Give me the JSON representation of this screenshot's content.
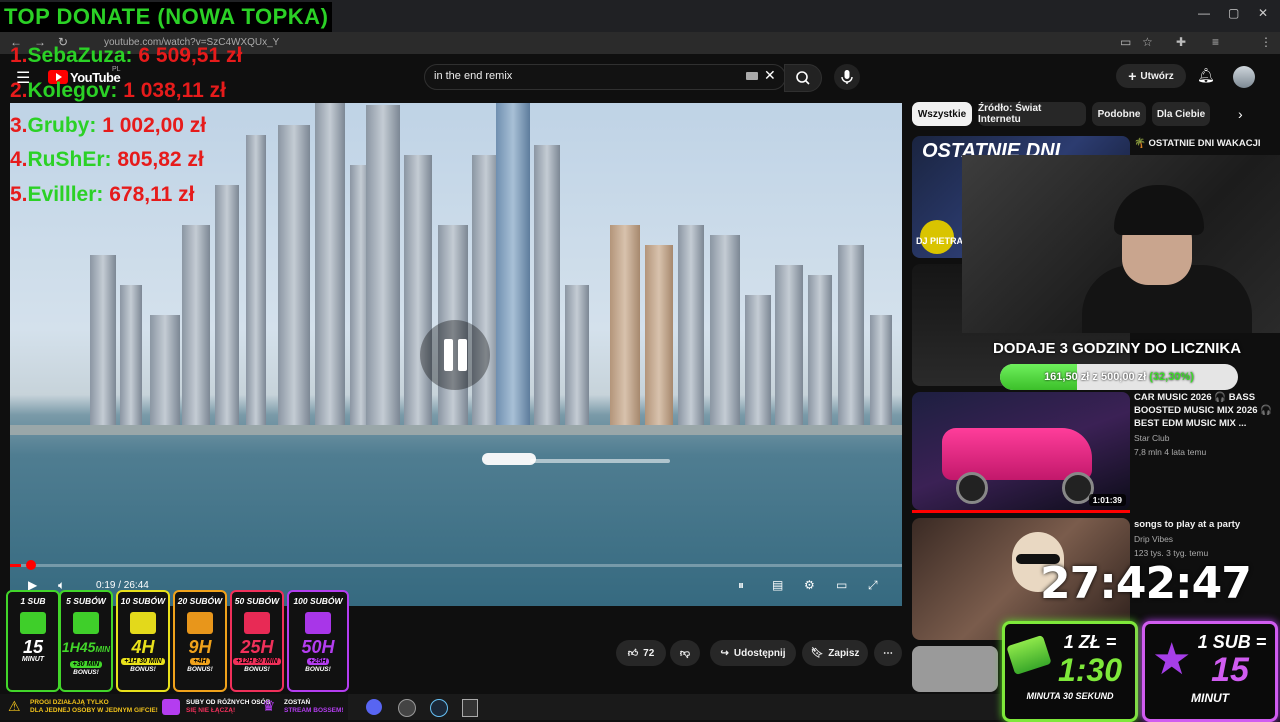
{
  "browser": {
    "url": "youtube.com/watch?v=SzC4WXQUx_Y",
    "window_controls": [
      "—",
      "▢",
      "✕"
    ]
  },
  "youtube": {
    "logo_text": "YouTube",
    "region": "PL",
    "search_query": "in the end remix",
    "create_label": "Utwórz"
  },
  "overlay": {
    "top_donate_title": "TOP DONATE (NOWA TOPKA)",
    "donors": [
      {
        "rank": "1.",
        "name": "SebaZuza:",
        "amount": "6 509,51 zł"
      },
      {
        "rank": "2.",
        "name": "Kolegov:",
        "amount": "1 038,11 zł"
      },
      {
        "rank": "3.",
        "name": "Gruby:",
        "amount": "1 002,00 zł"
      },
      {
        "rank": "4.",
        "name": "RuShEr:",
        "amount": "805,82 zł"
      },
      {
        "rank": "5.",
        "name": "Evilller:",
        "amount": "678,11 zł"
      }
    ],
    "goal_title": "DODAJE 3 GODZINY DO LICZNIKA",
    "goal_current": "161,50 zł",
    "goal_separator": "z",
    "goal_target": "500,00 zł",
    "goal_percent": "(32,30%)",
    "goal_fraction": 0.323,
    "timer": "27:42:47"
  },
  "player": {
    "current_time": "0:19",
    "duration": "26:44",
    "time_display": "0:19 / 26:44",
    "progress_fraction": 0.012
  },
  "sidebar": {
    "chips": [
      "Wszystkie",
      "Źródło: Świat Internetu",
      "Podobne",
      "Dla Ciebie"
    ],
    "videos": [
      {
        "title": "🌴 OSTATNIE DNI WAKACJI",
        "thumb_text": "OSTATNIE DNI",
        "thumb_sub": "DJ PIETRASS",
        "channel": "",
        "meta": ""
      },
      {
        "title": "CAR MUSIC 2026 🎧 BASS BOOSTED MUSIC MIX 2026 🎧 BEST EDM MUSIC MIX ...",
        "channel": "Star Club",
        "meta": "7,8 mln  4 lata temu",
        "duration": "1:01:39"
      },
      {
        "title": "songs to play at a party",
        "channel": "Drip Vibes",
        "meta": "123 tys.  3 tyg. temu"
      }
    ]
  },
  "actions": {
    "likes": "72",
    "share": "Udostępnij",
    "save": "Zapisz",
    "more": "⋯"
  },
  "tiers": [
    {
      "label": "1 SUB",
      "time": "15",
      "unit": "MINUT",
      "bonus": "",
      "color": "#42d62a",
      "gift": "#3fcf2a"
    },
    {
      "label": "5 SUBÓW",
      "time": "1H45",
      "unit": "MIN",
      "bonus": "+30 MIN",
      "bonus2": "BONUS!",
      "color": "#42d62a",
      "gift": "#3fcf2a"
    },
    {
      "label": "10 SUBÓW",
      "time": "4H",
      "unit": "",
      "bonus": "+1H 30 MIN",
      "bonus2": "BONUS!",
      "color": "#e9e11b",
      "gift": "#e3d91b"
    },
    {
      "label": "20 SUBÓW",
      "time": "9H",
      "unit": "",
      "bonus": "+4H",
      "bonus2": "BONUS!",
      "color": "#f0a21b",
      "gift": "#e8961b"
    },
    {
      "label": "50 SUBÓW",
      "time": "25H",
      "unit": "",
      "bonus": "+12H 30 MIN",
      "bonus2": "BONUS!",
      "color": "#f0305a",
      "gift": "#e82a55"
    },
    {
      "label": "100 SUBÓW",
      "time": "50H",
      "unit": "",
      "bonus": "+25H",
      "bonus2": "BONUS!",
      "color": "#b43df0",
      "gift": "#a836e8"
    }
  ],
  "info": {
    "warn1": "PROGI DZIAŁAJĄ TYLKO",
    "warn2": "DLA JEDNEJ OSOBY W JEDNYM GIFCIE!",
    "subs1": "SUBY OD RÓŻNYCH OSÓB",
    "subs2": "SIĘ NIE ŁĄCZĄ!",
    "boss1": "ZOSTAŃ",
    "boss2": "STREAM BOSSEM!"
  },
  "rates": {
    "money_label": "1 ZŁ =",
    "money_value": "1:30",
    "money_unit": "MINUTA 30 SEKUND",
    "sub_label": "1 SUB =",
    "sub_value": "15",
    "sub_unit": "MINUT"
  }
}
